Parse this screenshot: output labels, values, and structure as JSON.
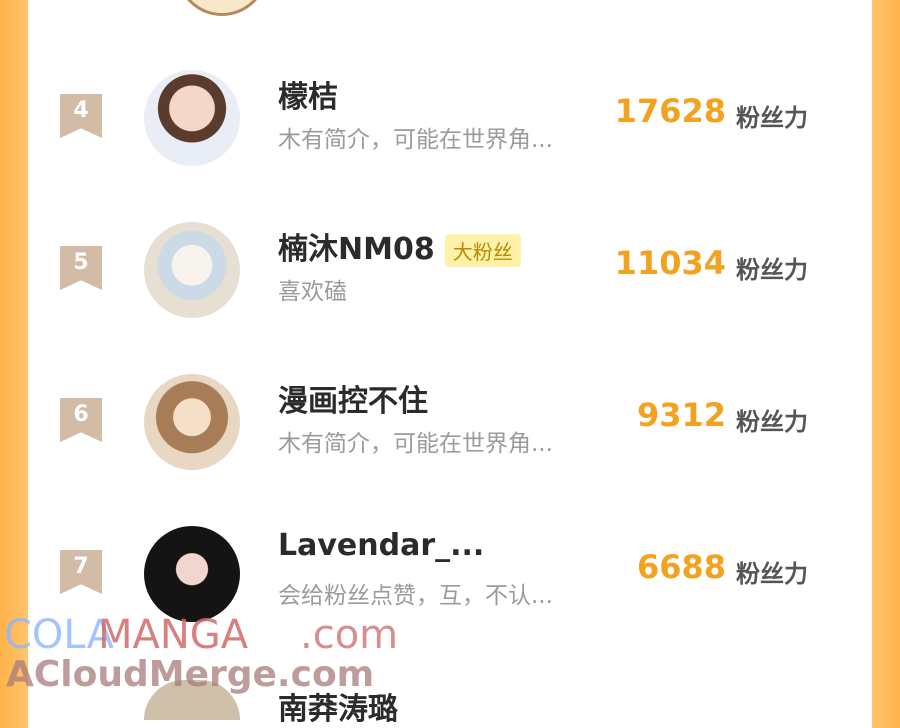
{
  "entries": [
    {
      "rank": "4",
      "name": "檬桔",
      "badge": "",
      "desc": "木有简介，可能在世界角...",
      "score": "17628",
      "unit": "粉丝力"
    },
    {
      "rank": "5",
      "name": "楠沐NM08",
      "badge": "大粉丝",
      "desc": "喜欢磕",
      "score": "11034",
      "unit": "粉丝力"
    },
    {
      "rank": "6",
      "name": "漫画控不住",
      "badge": "",
      "desc": "木有简介，可能在世界角...",
      "score": "9312",
      "unit": "粉丝力"
    },
    {
      "rank": "7",
      "name": "Lavendar_...",
      "badge": "",
      "desc": "会给粉丝点赞，互，不认...",
      "score": "6688",
      "unit": "粉丝力"
    }
  ],
  "next_entry": {
    "name": "南莽涛璐"
  },
  "watermark": {
    "line1a": "COLA",
    "line1b": "MANGA",
    "line1c": ".com",
    "line2": "ACloudMerge.com"
  },
  "colors": {
    "accent": "#f3a21f",
    "rank_bg": "#d2bca6",
    "side": "#ffb24a"
  }
}
